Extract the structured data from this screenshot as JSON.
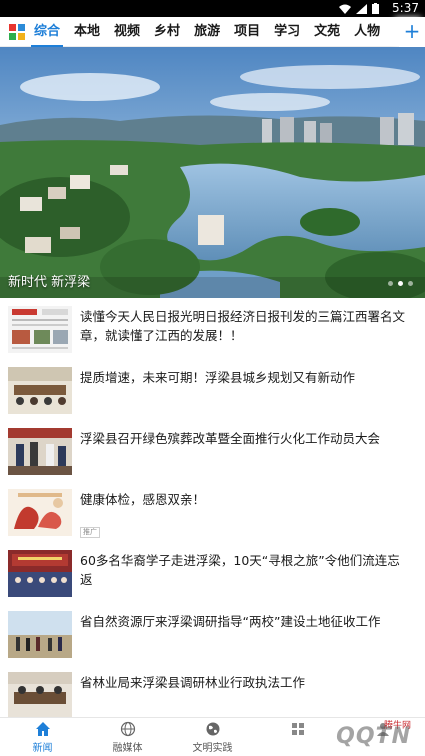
{
  "status_bar": {
    "time": "5:37",
    "icons": [
      "wifi-icon",
      "signal-icon",
      "battery-icon"
    ]
  },
  "top_tabs": {
    "items": [
      "综合",
      "本地",
      "视频",
      "乡村",
      "旅游",
      "项目",
      "学习",
      "文苑",
      "人物"
    ],
    "active_index": 0,
    "add_symbol": "+"
  },
  "banner": {
    "caption": "新时代 新浮梁",
    "slide_count": 3,
    "active_slide": 1
  },
  "news": [
    {
      "title": "读懂今天人民日报光明日报经济日报刊发的三篇江西署名文章，就读懂了江西的发展！！",
      "tag": ""
    },
    {
      "title": "提质增速，未来可期！浮梁县城乡规划又有新动作",
      "tag": ""
    },
    {
      "title": "浮梁县召开绿色殡葬改革暨全面推行火化工作动员大会",
      "tag": ""
    },
    {
      "title": "健康体检，感恩双亲！",
      "tag": "推广"
    },
    {
      "title": "60多名华裔学子走进浮梁，10天“寻根之旅”令他们流连忘返",
      "tag": ""
    },
    {
      "title": "省自然资源厅来浮梁调研指导“两校”建设土地征收工作",
      "tag": ""
    },
    {
      "title": "省林业局来浮梁县调研林业行政执法工作",
      "tag": ""
    }
  ],
  "bottom_nav": {
    "items": [
      {
        "label": "新闻",
        "icon": "home-icon"
      },
      {
        "label": "融媒体",
        "icon": "globe-icon"
      },
      {
        "label": "文明实践",
        "icon": "earth-icon"
      },
      {
        "label": "",
        "icon": ""
      },
      {
        "label": "",
        "icon": ""
      }
    ],
    "active_index": 0
  },
  "watermark": {
    "small": "腾牛网",
    "big": "QQTN"
  },
  "colors": {
    "accent": "#1e7fd8",
    "text": "#1a1a1a"
  }
}
